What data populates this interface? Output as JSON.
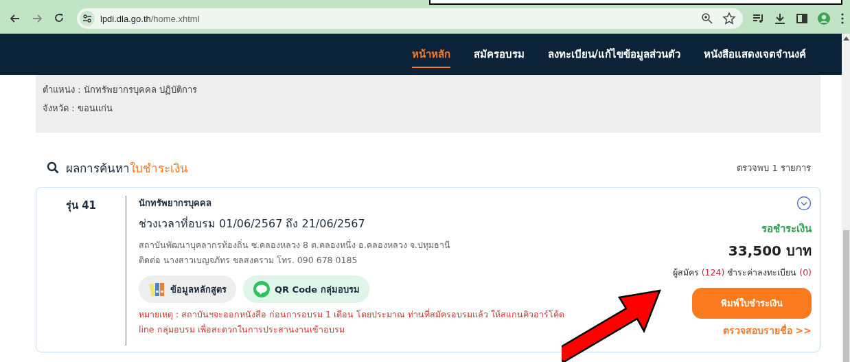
{
  "browser": {
    "url_host": "lpdi.dla.go.th",
    "url_path": "/home.xhtml"
  },
  "nav": {
    "items": [
      {
        "label": "หน้าหลัก",
        "selected": true
      },
      {
        "label": "สมัครอบรม",
        "selected": false
      },
      {
        "label": "ลงทะเบียน/แก้ไขข้อมูลส่วนตัว",
        "selected": false
      },
      {
        "label": "หนังสือแสดงเจตจำนงค์",
        "selected": false
      }
    ]
  },
  "profile": {
    "lines": [
      "ตำแหน่ง : นักทรัพยากรบุคคล ปฏิบัติการ",
      "จังหวัด : ขอนแก่น"
    ]
  },
  "results": {
    "title": "ผลการค้นหา",
    "title_highlight": "ใบชำระเงิน",
    "count": "ตรวจพบ 1 รายการ",
    "items": [
      {
        "batch": "รุ่น 41",
        "course": "นักทรัพยากรบุคคล",
        "period": "ช่วงเวลาที่อบรม 01/06/2567 ถึง 21/06/2567",
        "location": "สถาบันพัฒนาบุคลากรท้องถิ่น ซ.คลองหลวง 8 ต.คลองหนึ่ง อ.คลองหลวง จ.ปทุมธานี",
        "contact": "ติดต่อ นางสาวเบญจภัทร ชลสงคราม โทร. 090 678 0185",
        "buttons": [
          {
            "label": "ข้อมูลหลักสูตร",
            "kind": "folders"
          },
          {
            "label": "QR Code กลุ่มอบรม",
            "kind": "line"
          }
        ],
        "note": "หมายเหตุ : สถาบันฯจะออกหนังสือ ก่อนการอบรม 1 เดือน โดยประมาณ ท่านที่สมัครอบรมแล้ว ให้สแกนคิวอาร์โค้ด line กลุ่มอบรม เพื่อสะดวกในการประสานงานเข้าอบรม",
        "expanded": false,
        "status": "รอชำระเงิน",
        "price": "33,500 บาท",
        "applicants_label": "ผู้สมัคร",
        "applicants": "(124)",
        "paid_label": "ชำระค่าลงทะเบียน",
        "paid": "(0)",
        "print_button": "พิมพ์ใบชำระเงิน",
        "check_link": "ตรวจสอบรายชื่อ >>"
      }
    ]
  }
}
